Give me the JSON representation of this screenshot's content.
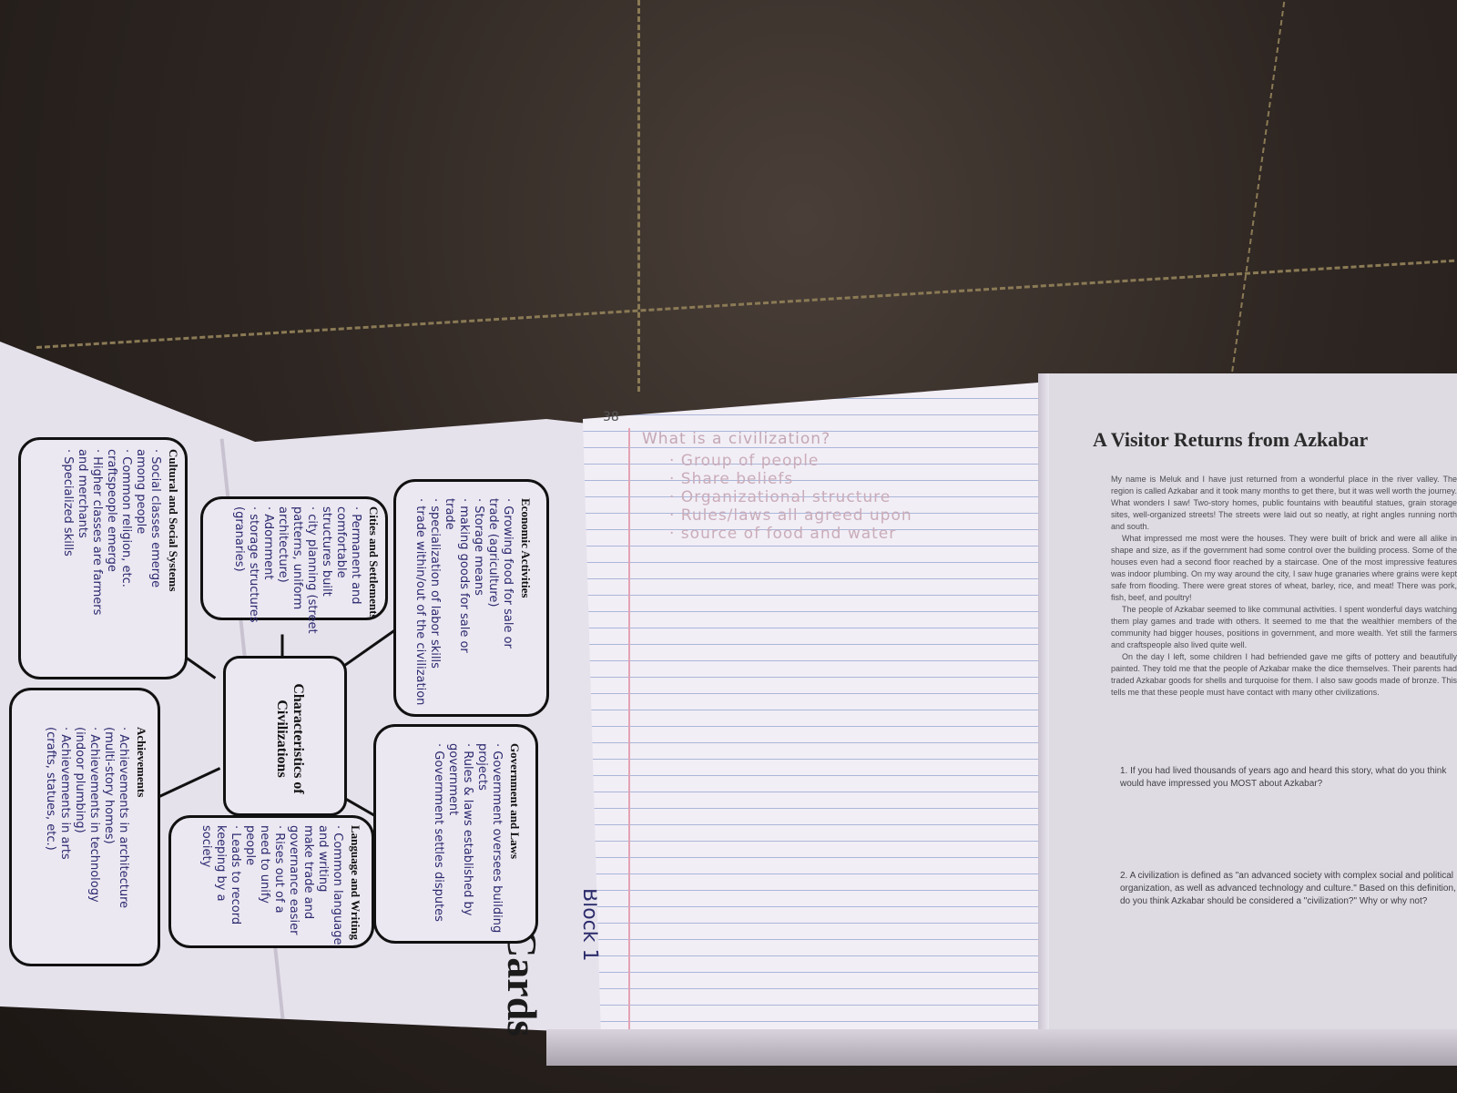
{
  "booklet": {
    "title": "It's in the Cards",
    "block_note": "Block 1",
    "center": "Characteristics of Civilizations",
    "cards": [
      {
        "title": "Economic Activities",
        "lines": [
          "· Growing food for sale or",
          "trade (agriculture)",
          "· Storage means",
          "· making goods for sale or",
          "trade",
          "· specialization of labor skills",
          "· trade within/out of the civilization"
        ]
      },
      {
        "title": "Government and Laws",
        "lines": [
          "· Government oversees building",
          "projects",
          "· Rules & laws established by",
          "government",
          "· Government settles disputes"
        ]
      },
      {
        "title": "Cities and Settlements",
        "lines": [
          "· Permanent and",
          "comfortable",
          "structures built",
          "· city planning (street",
          "patterns, uniform",
          "architecture)",
          "· Adornment",
          "· storage structures",
          "(granaries)"
        ]
      },
      {
        "title": "Language and Writing",
        "lines": [
          "· Common language",
          "and writing",
          "make trade and",
          "governance easier",
          "· Rises out of a",
          "need to unify",
          "people",
          "· Leads to record",
          "keeping by a",
          "society"
        ]
      },
      {
        "title": "Cultural and Social Systems",
        "lines": [
          "· Social classes emerge",
          "among people",
          "· Common religion, etc.",
          "craftspeople emerge",
          "· Higher classes are farmers",
          "and merchants",
          "· Specialized skills"
        ]
      },
      {
        "title": "Achievements",
        "lines": [
          "· Achievements in architecture",
          "(multi-story homes)",
          "· Achievements in technology",
          "(indoor plumbing)",
          "· Achievements in arts",
          "(crafts, statues, etc.)"
        ]
      }
    ]
  },
  "notebook": {
    "page_number": "38",
    "question": "What is a civilization?",
    "answers": [
      "· Group of people",
      "· Share beliefs",
      "· Organizational structure",
      "· Rules/laws all agreed upon",
      "· source of food and water"
    ]
  },
  "worksheet": {
    "title": "A Visitor Returns from Azkabar",
    "paragraph1": "My name is Meluk and I have just returned from a wonderful place in the river valley. The region is called Azkabar and it took many months to get there, but it was well worth the journey. What wonders I saw! Two-story homes, public fountains with beautiful statues, grain storage sites, well-organized streets! The streets were laid out so neatly, at right angles running north and south.",
    "paragraph2": "What impressed me most were the houses. They were built of brick and were all alike in shape and size, as if the government had some control over the building process. Some of the houses even had a second floor reached by a staircase. One of the most impressive features was indoor plumbing. On my way around the city, I saw huge granaries where grains were kept safe from flooding. There were great stores of wheat, barley, rice, and meat! There was pork, fish, beef, and poultry!",
    "paragraph3": "The people of Azkabar seemed to like communal activities. I spent wonderful days watching them play games and trade with others. It seemed to me that the wealthier members of the community had bigger houses, positions in government, and more wealth. Yet still the farmers and craftspeople also lived quite well.",
    "paragraph4": "On the day I left, some children I had befriended gave me gifts of pottery and beautifully painted. They told me that the people of Azkabar make the dice themselves. Their parents had traded Azkabar goods for shells and turquoise for them. I also saw goods made of bronze. This tells me that these people must have contact with many other civilizations.",
    "question1": "1. If you had lived thousands of years ago and heard this story, what do you think would have impressed you MOST about Azkabar?",
    "question2": "2. A civilization is defined as \"an advanced society with complex social and political organization, as well as advanced technology and culture.\" Based on this definition, do you think Azkabar should be considered a \"civilization?\" Why or why not?"
  }
}
